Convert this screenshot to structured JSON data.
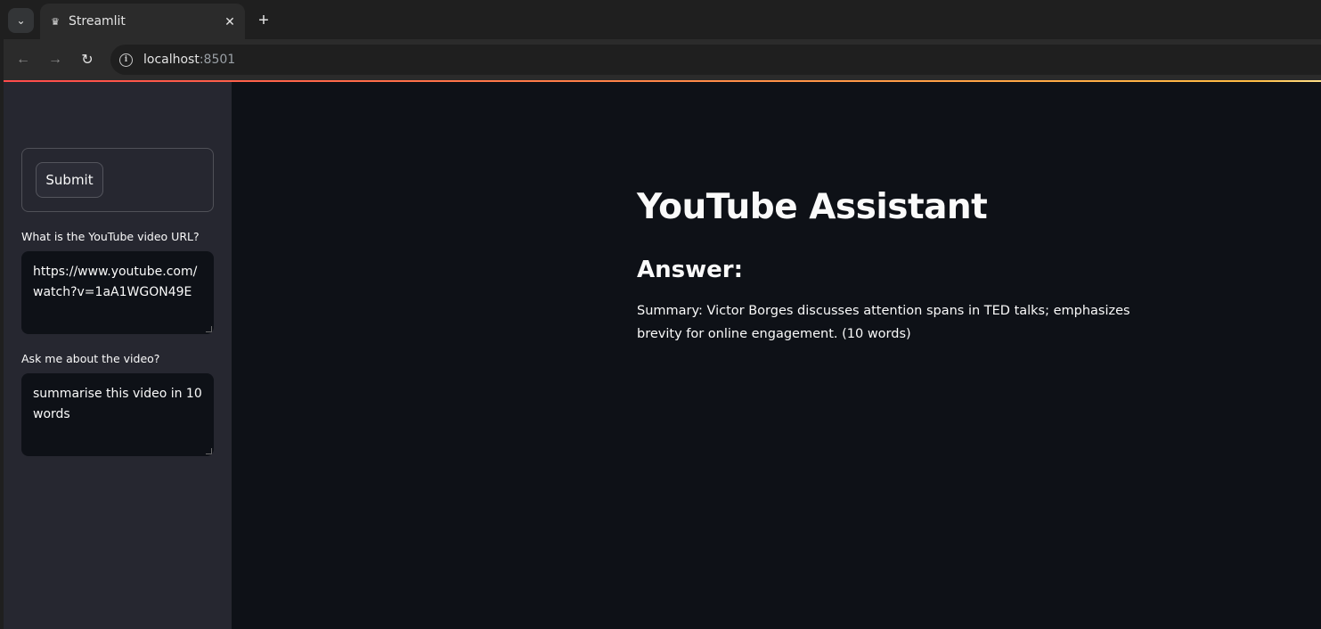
{
  "browser": {
    "tab_title": "Streamlit",
    "url_host": "localhost",
    "url_port": ":8501",
    "icons": {
      "tab_menu": "chevron-down-icon",
      "favicon": "streamlit-crown-icon",
      "close": "close-icon",
      "new_tab": "plus-icon",
      "back": "arrow-left-icon",
      "forward": "arrow-right-icon",
      "reload": "reload-icon",
      "site_info": "info-icon"
    }
  },
  "sidebar": {
    "submit_label": "Submit",
    "url_label": "What is the YouTube video URL?",
    "url_value": "https://www.youtube.com/watch?v=1aA1WGON49E",
    "question_label": "Ask me about the video?",
    "question_value": "summarise this video in 10 words"
  },
  "main": {
    "title": "YouTube Assistant",
    "answer_heading": "Answer:",
    "answer_text": "Summary: Victor Borges discusses attention spans in TED talks; emphasizes brevity for online engagement. (10 words)"
  },
  "colors": {
    "app_background": "#0e1117",
    "sidebar_background": "#262730",
    "accent_start": "#ff4b4b",
    "accent_end": "#ffbd45"
  }
}
